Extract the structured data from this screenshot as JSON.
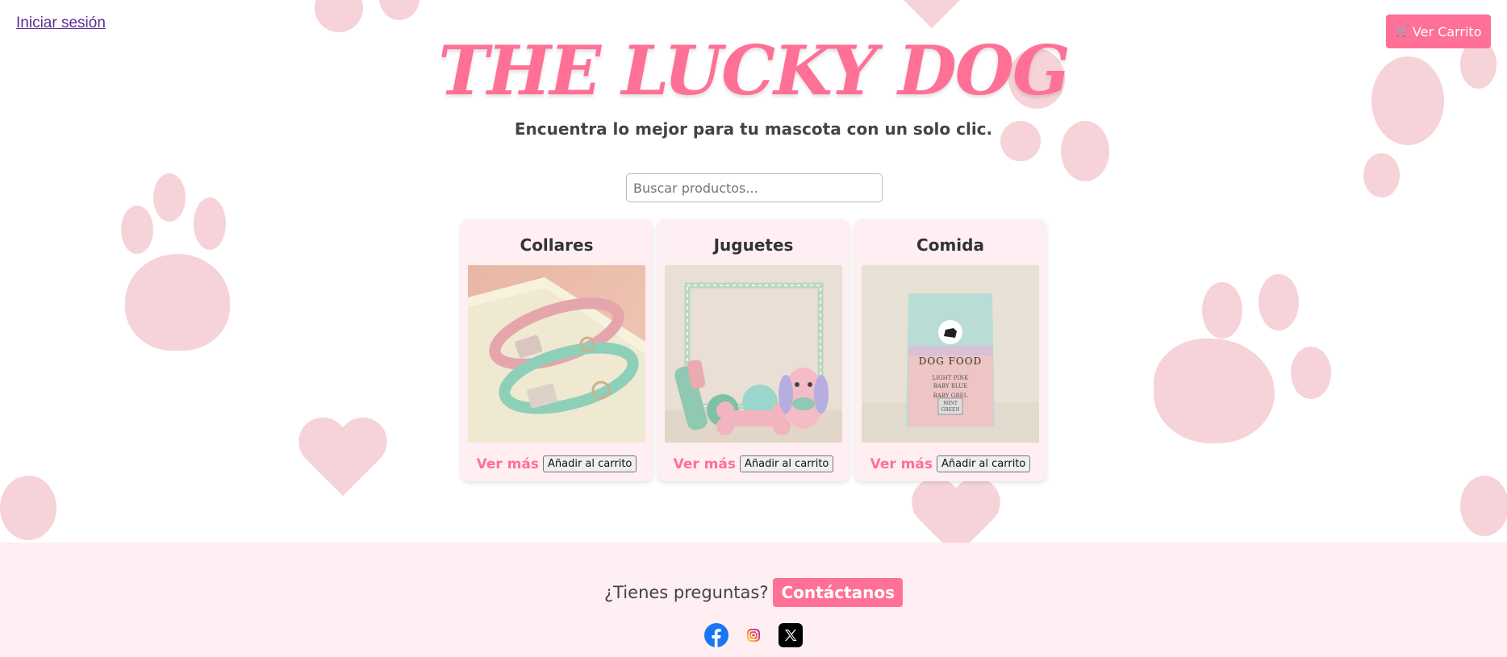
{
  "header": {
    "login_label": "Iniciar sesión",
    "cart_label": "Ver Carrito",
    "cart_icon": "cart-icon",
    "title": "THE LUCKY DOG",
    "tagline": "Encuentra lo mejor para tu mascota con un solo clic."
  },
  "search": {
    "placeholder": "Buscar productos...",
    "value": ""
  },
  "products": [
    {
      "title": "Collares",
      "more_label": "Ver más",
      "add_label": "Añadir al carrito",
      "image": "pastel dog collars"
    },
    {
      "title": "Juguetes",
      "more_label": "Ver más",
      "add_label": "Añadir al carrito",
      "image": "pastel dog toys"
    },
    {
      "title": "Comida",
      "more_label": "Ver más",
      "add_label": "Añadir al carrito",
      "image": "dog food bag"
    }
  ],
  "food_bag": {
    "label": "DOG FOOD",
    "line1": "LIGHT PINK",
    "line2": "BABY BLUE",
    "line3": "BABY GREL",
    "tag1": "MINT",
    "tag2": "GREEN"
  },
  "footer": {
    "question": "¿Tienes preguntas?",
    "contact_label": "Contáctanos",
    "socials": [
      "facebook-icon",
      "instagram-icon",
      "x-icon"
    ]
  },
  "colors": {
    "accent": "#ff7096",
    "card_bg": "#ffeef2",
    "footer_bg": "#ffeef2",
    "paw": "#f6d3d8"
  }
}
